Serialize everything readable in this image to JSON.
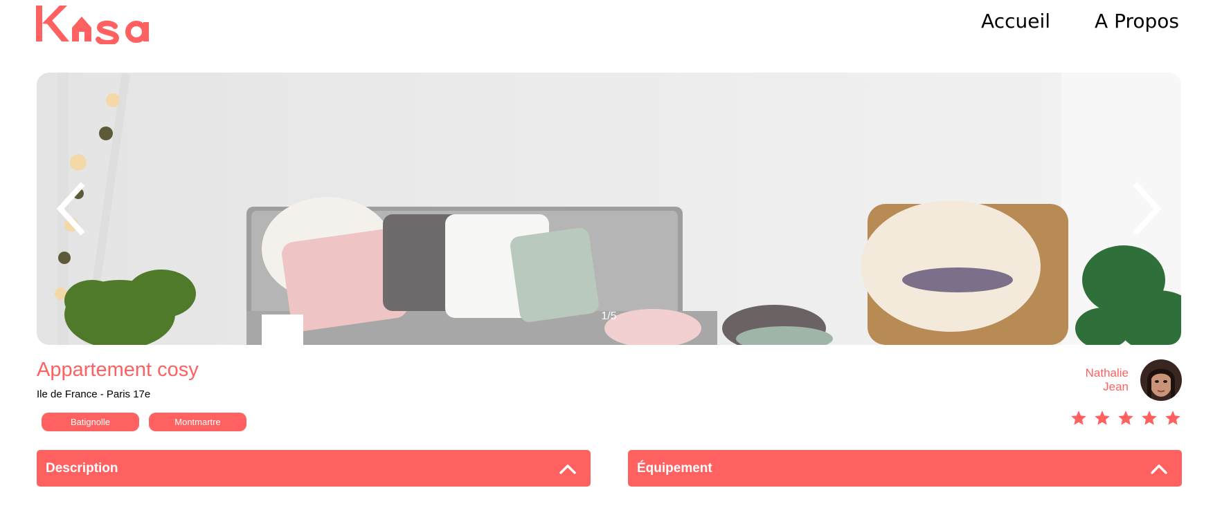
{
  "header": {
    "logo_text": "Kasa",
    "nav": [
      {
        "label": "Accueil"
      },
      {
        "label": "A Propos"
      }
    ]
  },
  "carousel": {
    "counter": "1/5"
  },
  "listing": {
    "title": "Appartement cosy",
    "location": "Ile de France - Paris 17e",
    "tags": [
      "Batignolle",
      "Montmartre"
    ],
    "host": {
      "first_name": "Nathalie",
      "last_name": "Jean"
    },
    "rating": 5
  },
  "collapses": {
    "description": "Description",
    "equipment": "Équipement"
  },
  "colors": {
    "accent": "#FF6060"
  }
}
